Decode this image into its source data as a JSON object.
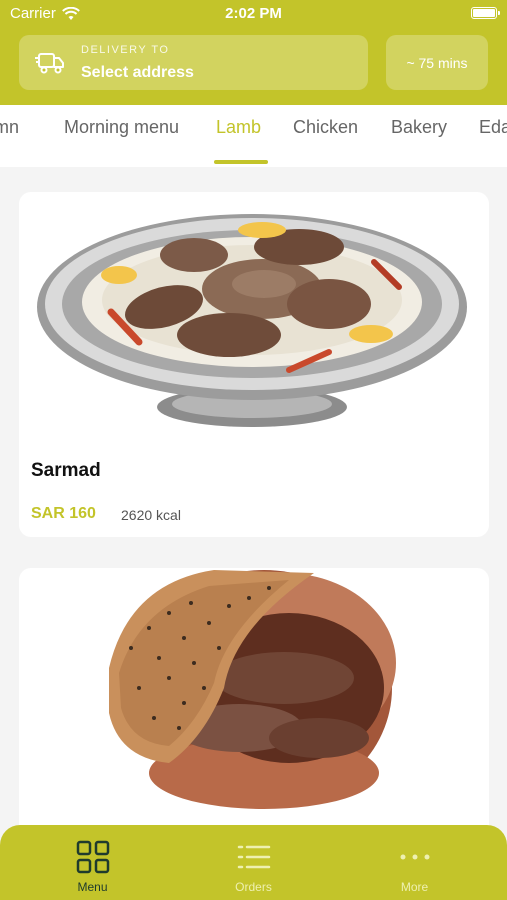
{
  "status_bar": {
    "carrier": "Carrier",
    "time": "2:02 PM"
  },
  "delivery": {
    "label": "DELIVERY TO",
    "address": "Select address",
    "eta": "~ 75 mins"
  },
  "tabs": [
    {
      "label": "mn"
    },
    {
      "label": "Morning menu"
    },
    {
      "label": "Lamb"
    },
    {
      "label": "Chicken"
    },
    {
      "label": "Bakery"
    },
    {
      "label": "Eda"
    }
  ],
  "active_tab": "Lamb",
  "items": [
    {
      "name": "Sarmad",
      "price": "SAR 160",
      "kcal": "2620 kcal"
    }
  ],
  "bottom_nav": [
    {
      "label": "Menu",
      "icon": "grid-icon"
    },
    {
      "label": "Orders",
      "icon": "list-icon"
    },
    {
      "label": "More",
      "icon": "more-dots-icon"
    }
  ],
  "colors": {
    "accent": "#c3c42a",
    "active_nav": "#1f3b2d"
  }
}
